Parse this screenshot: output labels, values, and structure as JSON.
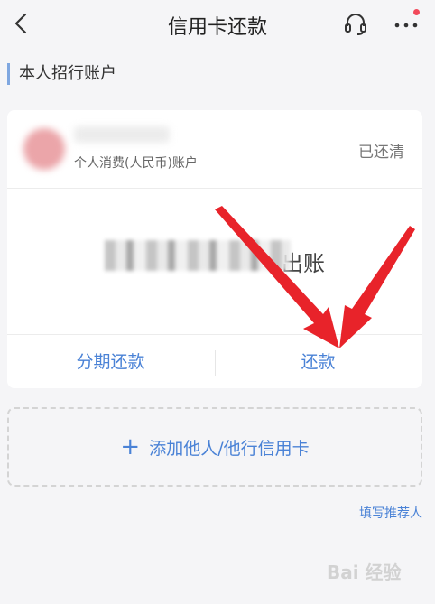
{
  "nav": {
    "title": "信用卡还款",
    "back_icon": "back-arrow-icon",
    "headset_icon": "headset-icon",
    "more_icon": "more-icon",
    "badge_color": "#f2495a"
  },
  "section": {
    "title": "本人招行账户"
  },
  "account": {
    "type_label": "个人消费(人民币)账户",
    "status": "已还清",
    "bill_suffix": "出账"
  },
  "actions": {
    "installment": "分期还款",
    "repay": "还款"
  },
  "add_card": {
    "plus": "+",
    "label": "添加他人/他行信用卡"
  },
  "referrer": "填写推荐人",
  "watermark": "Bai 经验",
  "colors": {
    "accent": "#4a82d6",
    "arrow": "#e8232a"
  }
}
